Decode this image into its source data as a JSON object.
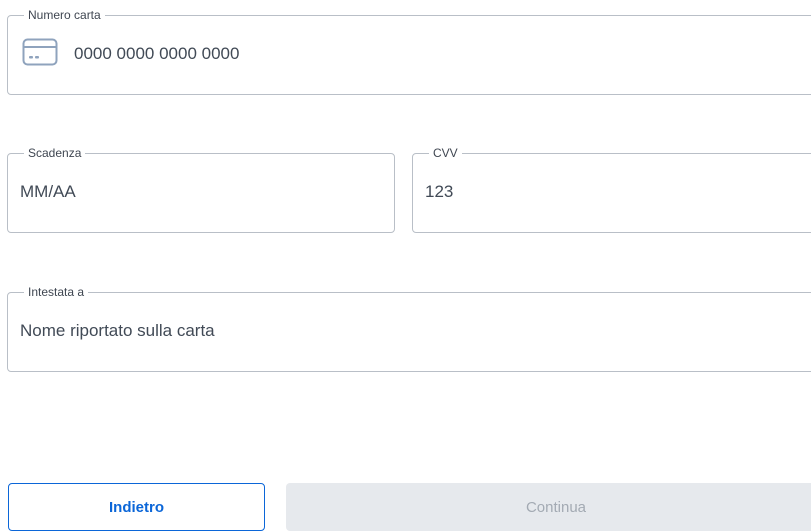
{
  "form": {
    "card_number": {
      "label": "Numero carta",
      "placeholder": "0000 0000 0000 0000",
      "icon": "credit-card-icon"
    },
    "expiry": {
      "label": "Scadenza",
      "placeholder": "MM/AA"
    },
    "cvv": {
      "label": "CVV",
      "placeholder": "123"
    },
    "holder": {
      "label": "Intestata a",
      "placeholder": "Nome riportato sulla carta"
    }
  },
  "actions": {
    "back_label": "Indietro",
    "continue_label": "Continua"
  },
  "colors": {
    "primary": "#0b66d8",
    "border": "#b9bfc7",
    "disabled_bg": "#e6e9ed",
    "disabled_text": "#a3aab3"
  }
}
